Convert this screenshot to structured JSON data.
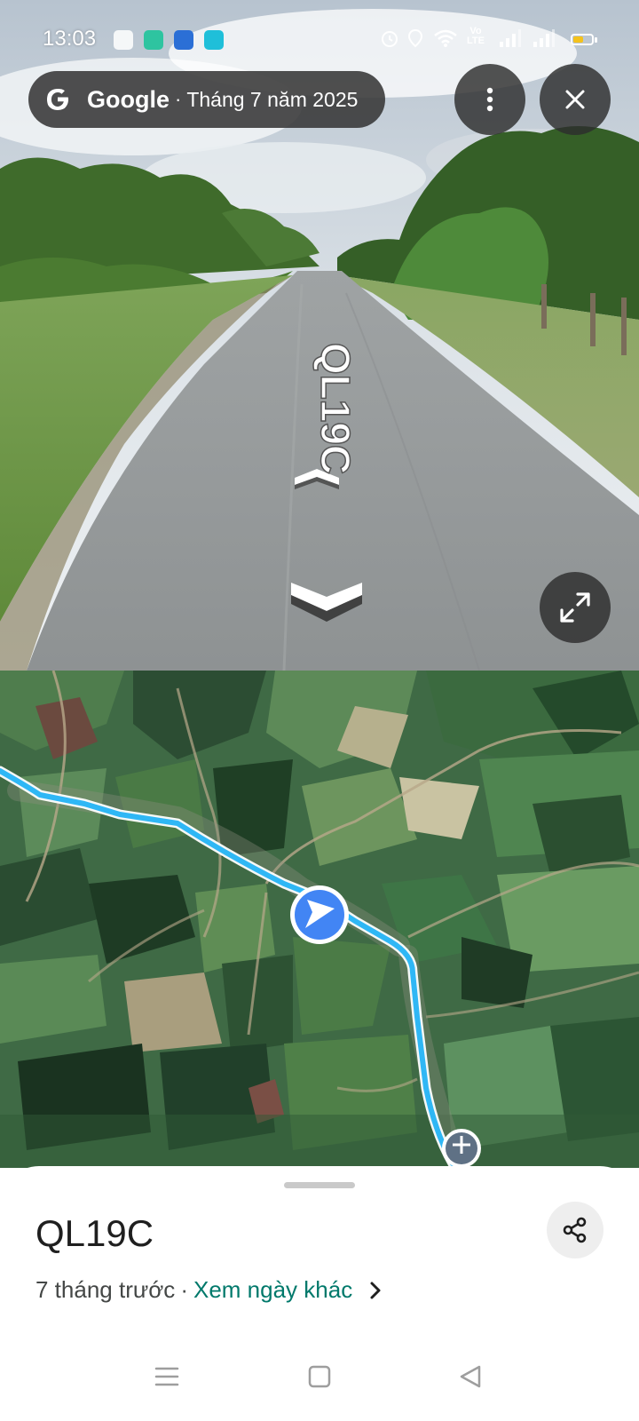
{
  "status_bar": {
    "time": "13:03",
    "network_label_top": "Vo",
    "network_label_bottom": "LTE",
    "battery_level": 0.55,
    "battery_color": "#f4c21c"
  },
  "street_view": {
    "brand": "Google",
    "separator": "·",
    "capture_date": "Tháng 7 năm 2025",
    "road_label": "QL19C",
    "icons": {
      "logo": "google-g-logo",
      "more": "more-vert-icon",
      "close": "close-icon",
      "expand": "fullscreen-icon",
      "nav_forward": "chevron-forward-icon",
      "nav_back": "chevron-back-icon"
    }
  },
  "map": {
    "route_color": "#2fb7f5",
    "location_marker_color": "#4285f4",
    "icons": {
      "marker": "navigation-arrow-icon",
      "destination": "destination-pin-icon"
    }
  },
  "bottom_sheet": {
    "title": "QL19C",
    "time_ago": "7 tháng trước",
    "separator": "·",
    "other_dates_link": "Xem ngày khác",
    "accent_color": "#00796b",
    "icons": {
      "share": "share-icon",
      "link_chevron": "chevron-right-icon"
    }
  },
  "system_nav": {
    "icons": [
      "menu-icon",
      "home-icon",
      "back-icon"
    ]
  }
}
